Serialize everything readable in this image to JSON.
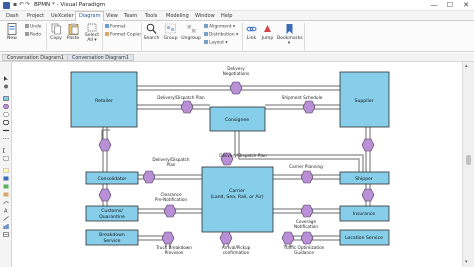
{
  "window": {
    "title": "BPMN * - Visual Paradigm",
    "minimize": "—",
    "maximize": "☐",
    "close": "✕"
  },
  "menu": {
    "tabs": [
      "Dash",
      "Project",
      "UeXceler",
      "Diagram",
      "View",
      "Team",
      "Tools",
      "Modeling",
      "Window",
      "Help"
    ],
    "active": "Diagram"
  },
  "ribbon": {
    "new": "New",
    "undo": "Undo",
    "redo": "Redo",
    "copy": "Copy",
    "paste": "Paste",
    "select_all_1": "Select",
    "select_all_2": "All ▾",
    "format": "Format",
    "format_copier": "Format Copier",
    "search": "Search",
    "group": "Group",
    "ungroup": "Ungroup",
    "alignment": "Alignment ▾",
    "distribution": "Distribution ▾",
    "layout": "Layout ▾",
    "link": "Link",
    "jump": "Jump",
    "bookmarks": "Bookmarks",
    "bookmarks_more": "▾"
  },
  "breadcrumb": [
    "Conversation Diagram1",
    "Conversation Diagram1"
  ],
  "diagram": {
    "participants": {
      "retailer": "Retailer",
      "supplier": "Supplier",
      "consignee": "Consignee",
      "consolidator": "Consolidator",
      "shipper": "Shipper",
      "carrier_1": "Carrier",
      "carrier_2": "(Land, Sea, Rail, or Air)",
      "customs_1": "Customs/",
      "customs_2": "Quarantine",
      "insurance": "Insurance",
      "breakdown_1": "Breakdown",
      "breakdown_2": "Service",
      "location": "Location Service"
    },
    "conversations": {
      "delivery_negotiations_1": "Delivery",
      "delivery_negotiations_2": "Negotiations",
      "dispatch_top": "Delivery/Dispatch Plan",
      "shipment_schedule": "Shipment Schedule",
      "dispatch_mid_1": "Delivery/Dispatch",
      "dispatch_mid_2": "Plan",
      "dispatch_right": "Delivery/Dispatch Plan",
      "carrier_planning": "Carrier Planning",
      "clearance_1": "Clearance",
      "clearance_2": "Pre-Notification",
      "coverage_1": "Coverage",
      "coverage_2": "Notification",
      "truck_breakdown_1": "Truck Breakdown",
      "truck_breakdown_2": "Provision",
      "arrival_pickup_1": "Arrival/Pickup",
      "arrival_pickup_2": "confirmation",
      "traffic_opt_1": "Traffic Optimization",
      "traffic_opt_2": "Guidance"
    }
  },
  "colors": {
    "participant_fill": "#87ceeb",
    "conversation_fill": "#b98fd6",
    "link": "#6b6b6b",
    "active_tab": "#1a4f9c"
  }
}
